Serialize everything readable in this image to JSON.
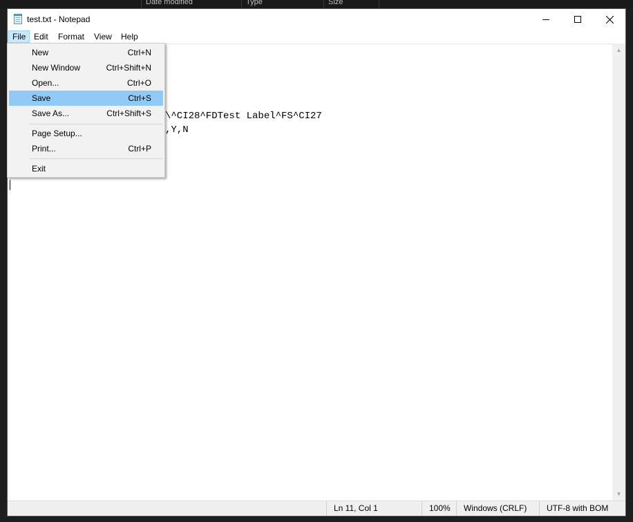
{
  "background": {
    "columns": [
      "Date modified",
      "Type",
      "Size"
    ]
  },
  "window": {
    "title": "test.txt - Notepad",
    "icon": "notepad-icon",
    "controls": {
      "minimize": "minimize-icon",
      "maximize": "maximize-icon",
      "close": "close-icon"
    }
  },
  "menubar": {
    "items": [
      "File",
      "Edit",
      "Format",
      "View",
      "Help"
    ],
    "active": "File"
  },
  "file_menu": {
    "items": [
      {
        "label": "New",
        "shortcut": "Ctrl+N"
      },
      {
        "label": "New Window",
        "shortcut": "Ctrl+Shift+N"
      },
      {
        "label": "Open...",
        "shortcut": "Ctrl+O"
      },
      {
        "label": "Save",
        "shortcut": "Ctrl+S",
        "highlighted": true
      },
      {
        "label": "Save As...",
        "shortcut": "Ctrl+Shift+S"
      },
      {
        "label": "Page Setup...",
        "shortcut": ""
      },
      {
        "label": "Print...",
        "shortcut": "Ctrl+P"
      },
      {
        "label": "Exit",
        "shortcut": ""
      }
    ]
  },
  "editor": {
    "visible_lines": [
      "\\^CI28^FDTest Label^FS^CI27",
      ",Y,N"
    ]
  },
  "statusbar": {
    "position": "Ln 11, Col 1",
    "zoom": "100%",
    "line_ending": "Windows (CRLF)",
    "encoding": "UTF-8 with BOM"
  },
  "colors": {
    "menu_active_bg": "#cce8ff",
    "menu_highlight": "#91c9f7",
    "dropdown_bg": "#f2f2f2",
    "statusbar_bg": "#f0f0f0"
  }
}
